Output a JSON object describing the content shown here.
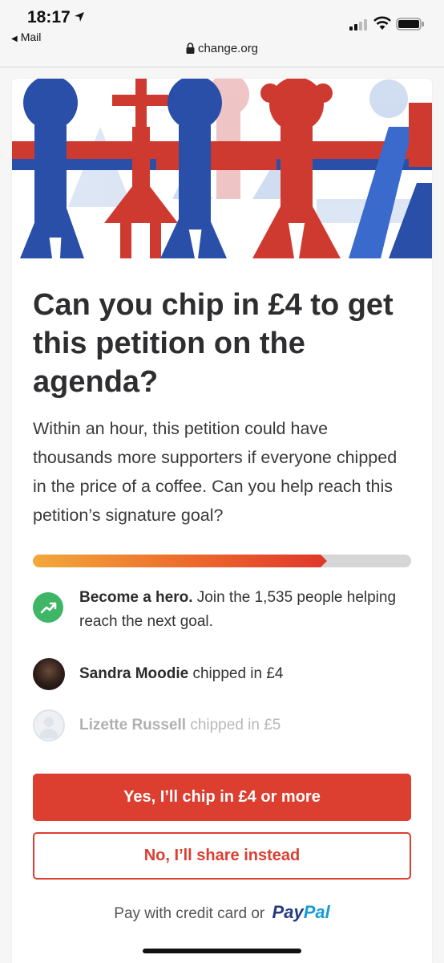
{
  "status_bar": {
    "time": "18:17",
    "back_label": "Mail"
  },
  "url_bar": {
    "domain": "change.org"
  },
  "main": {
    "title": "Can you chip in £4 to get this petition on the agenda?",
    "description": "Within an hour, this petition could have thousands more supporters if everyone chipped in the price of a coffee. Can you help reach this petition’s signature goal?",
    "progress_fraction": 0.76,
    "hero_row": {
      "bold": "Become a hero.",
      "text": " Join the 1,535 people helping reach the next goal."
    },
    "supporters": [
      {
        "name": "Sandra Moodie",
        "action": " chipped in £4"
      },
      {
        "name": "Lizette Russell",
        "action": " chipped in £5"
      }
    ],
    "primary_button": "Yes, I’ll chip in £4 or more",
    "secondary_button": "No, I’ll share instead",
    "pay_text": "Pay with credit card or",
    "paypal_a": "Pay",
    "paypal_b": "Pal"
  },
  "colors": {
    "accent": "#dc3e30",
    "hero_icon": "#3fb566"
  },
  "icons": [
    "location-arrow-icon",
    "signal-icon",
    "wifi-icon",
    "battery-icon",
    "lock-icon",
    "trending-up-icon"
  ]
}
